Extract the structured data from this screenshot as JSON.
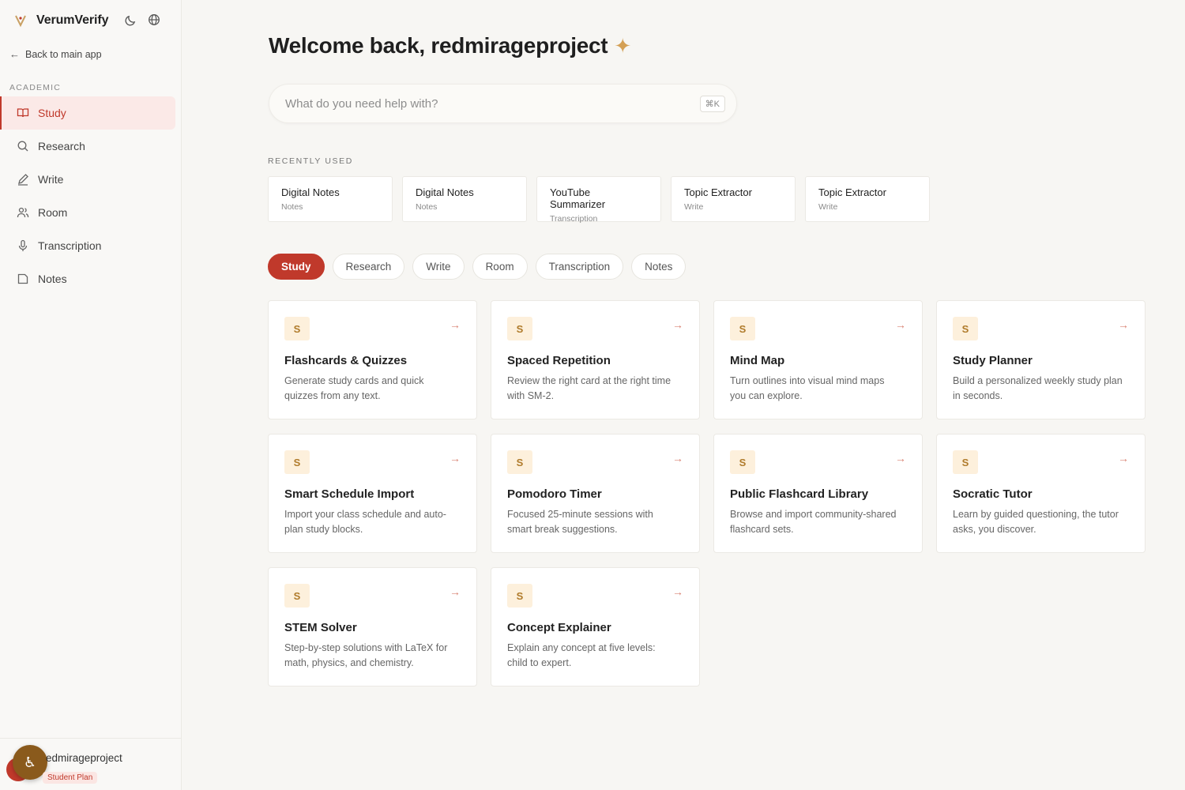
{
  "brand": {
    "name": "VerumVerify"
  },
  "sidebar": {
    "back_label": "Back to main app",
    "section_label": "ACADEMIC",
    "items": [
      {
        "label": "Study",
        "icon": "book-open-icon",
        "active": true
      },
      {
        "label": "Research",
        "icon": "search-icon",
        "active": false
      },
      {
        "label": "Write",
        "icon": "pen-icon",
        "active": false
      },
      {
        "label": "Room",
        "icon": "users-icon",
        "active": false
      },
      {
        "label": "Transcription",
        "icon": "microphone-icon",
        "active": false
      },
      {
        "label": "Notes",
        "icon": "note-icon",
        "active": false
      }
    ],
    "user": {
      "name": "redmirageproject",
      "name_visible": "edmirageproject",
      "plan": "Student Plan"
    }
  },
  "main": {
    "title": "Welcome back, redmirageproject",
    "search": {
      "placeholder": "What do you need help with?",
      "shortcut": "⌘K"
    },
    "recent_label": "RECENTLY USED",
    "recent": [
      {
        "title": "Digital Notes",
        "category": "Notes"
      },
      {
        "title": "Digital Notes",
        "category": "Notes"
      },
      {
        "title": "YouTube Summarizer",
        "category": "Transcription"
      },
      {
        "title": "Topic Extractor",
        "category": "Write"
      },
      {
        "title": "Topic Extractor",
        "category": "Write"
      }
    ],
    "tabs": [
      {
        "label": "Study",
        "active": true
      },
      {
        "label": "Research",
        "active": false
      },
      {
        "label": "Write",
        "active": false
      },
      {
        "label": "Room",
        "active": false
      },
      {
        "label": "Transcription",
        "active": false
      },
      {
        "label": "Notes",
        "active": false
      }
    ],
    "tools": [
      {
        "badge": "S",
        "title": "Flashcards & Quizzes",
        "desc": "Generate study cards and quick quizzes from any text."
      },
      {
        "badge": "S",
        "title": "Spaced Repetition",
        "desc": "Review the right card at the right time with SM-2."
      },
      {
        "badge": "S",
        "title": "Mind Map",
        "desc": "Turn outlines into visual mind maps you can explore."
      },
      {
        "badge": "S",
        "title": "Study Planner",
        "desc": "Build a personalized weekly study plan in seconds."
      },
      {
        "badge": "S",
        "title": "Smart Schedule Import",
        "desc": "Import your class schedule and auto-plan study blocks."
      },
      {
        "badge": "S",
        "title": "Pomodoro Timer",
        "desc": "Focused 25-minute sessions with smart break suggestions."
      },
      {
        "badge": "S",
        "title": "Public Flashcard Library",
        "desc": "Browse and import community-shared flashcard sets."
      },
      {
        "badge": "S",
        "title": "Socratic Tutor",
        "desc": "Learn by guided questioning, the tutor asks, you discover."
      },
      {
        "badge": "S",
        "title": "STEM Solver",
        "desc": "Step-by-step solutions with LaTeX for math, physics, and chemistry."
      },
      {
        "badge": "S",
        "title": "Concept Explainer",
        "desc": "Explain any concept at five levels: child to expert."
      }
    ]
  },
  "colors": {
    "accent": "#c0392b",
    "badge_bg": "#fdf0dc",
    "badge_fg": "#b07b2b",
    "background": "#f7f6f3"
  }
}
